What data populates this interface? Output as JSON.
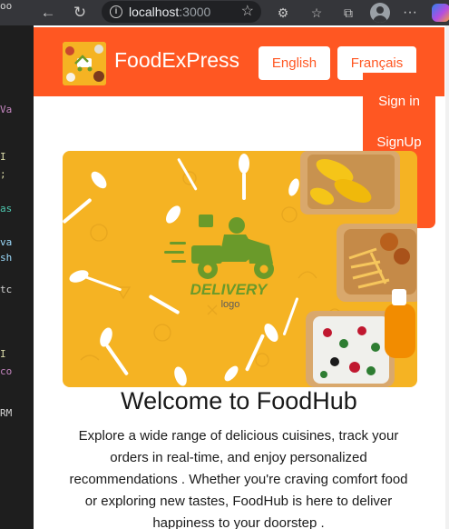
{
  "browser": {
    "address": {
      "host": "localhost",
      "port": ":3000"
    }
  },
  "site": {
    "brand": "FoodExPress",
    "lang_buttons": [
      "English",
      "Français"
    ],
    "menu": [
      "Sign in",
      "SignUp"
    ]
  },
  "hero": {
    "watermark": "DELIVERY",
    "watermark_sub": "logo"
  },
  "content": {
    "heading": "Welcome to FoodHub",
    "description": "Explore a wide range of delicious cuisines, track your orders in real-time, and enjoy personalized recommendations . Whether you're craving comfort food or exploring new tastes, FoodHub is here to deliver happiness to your doorstep ."
  },
  "editor_fragments": [
    "oo",
    "Va",
    "I",
    ";",
    "as",
    "va",
    "sh",
    "tc",
    "I",
    "co",
    "RM"
  ],
  "colors": {
    "accent": "#ff5722",
    "hero_bg": "#f5b323",
    "delivery_green": "#6a9a2a"
  },
  "icons": [
    "back-arrow-icon",
    "reload-icon",
    "info-icon",
    "star-icon",
    "extensions-icon",
    "favorites-icon",
    "collections-icon",
    "profile-icon",
    "more-icon",
    "copilot-icon"
  ]
}
